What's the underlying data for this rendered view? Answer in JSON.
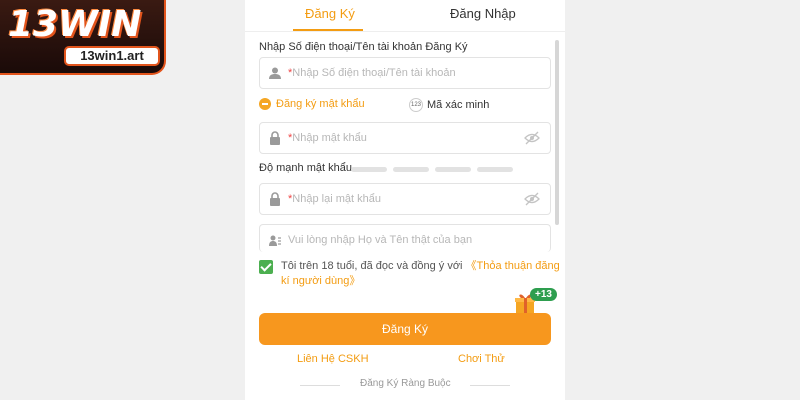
{
  "brand": {
    "logo_text": "13WIN",
    "site": "13win1.art",
    "accent": "#f39c12",
    "logo_accent": "#e2541c"
  },
  "tabs": {
    "register": "Đăng Ký",
    "login": "Đăng Nhập"
  },
  "form": {
    "account_label": "Nhập Số điện thoại/Tên tài khoản Đăng Ký",
    "account_placeholder": "Nhập Số điện thoại/Tên tài khoản",
    "mode_password": "Đăng ký mật khẩu",
    "mode_otp": "Mã xác minh",
    "otp_icon_text": "123",
    "password_placeholder": "Nhập mật khẩu",
    "strength_label": "Độ mạnh mật khẩu",
    "confirm_placeholder": "Nhập lại mật khẩu",
    "fullname_placeholder": "Vui lòng nhập Họ và Tên thật của bạn",
    "required_mark": "*",
    "agree_text": "Tôi trên 18 tuổi, đã đọc và đồng ý với ",
    "agree_link": "《Thỏa thuận đăng kí người dùng》",
    "agree_checked": true,
    "gift_badge": "+13",
    "submit": "Đăng Ký"
  },
  "footer": {
    "contact": "Liên Hệ CSKH",
    "trial": "Chơi Thử",
    "bind": "Đăng Ký Ràng Buộc"
  },
  "icons": [
    "user-icon",
    "lock-icon",
    "eye-off-icon",
    "id-card-icon",
    "gift-icon",
    "check-icon"
  ]
}
